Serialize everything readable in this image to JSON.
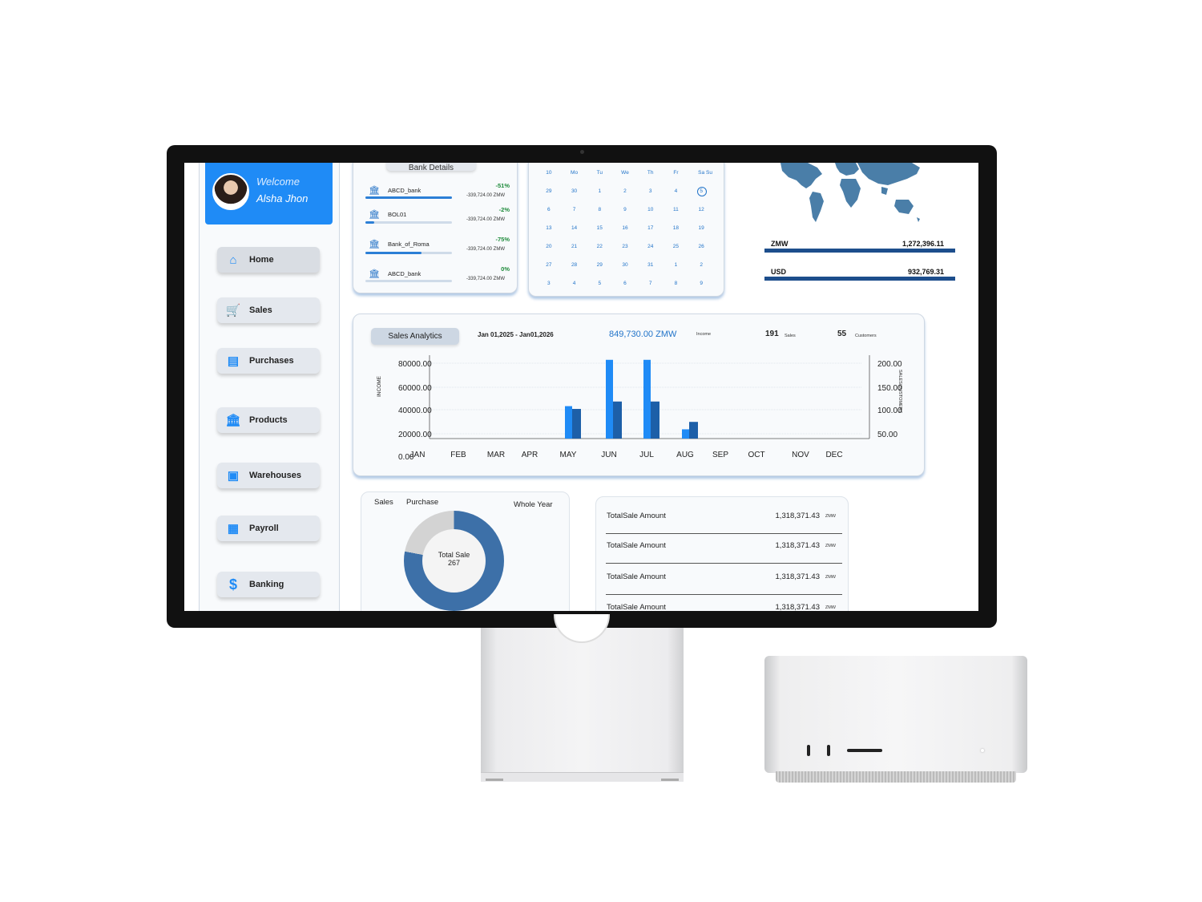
{
  "user": {
    "welcome": "Welcome",
    "name": "Alsha Jhon"
  },
  "nav": [
    {
      "label": "Home",
      "icon": "home-icon"
    },
    {
      "label": "Sales",
      "icon": "cart-icon"
    },
    {
      "label": "Purchases",
      "icon": "clipboard-icon"
    },
    {
      "label": "Products",
      "icon": "bank-icon"
    },
    {
      "label": "Warehouses",
      "icon": "briefcase-icon"
    },
    {
      "label": "Payroll",
      "icon": "register-icon"
    },
    {
      "label": "Banking",
      "icon": "dollar-icon"
    }
  ],
  "bank_details": {
    "title": "Bank Details",
    "rows": [
      {
        "name": "ABCD_bank",
        "pct": "-51%",
        "amount": "-339,724.00 ZMW",
        "fill": 1.0
      },
      {
        "name": "BOL01",
        "pct": "-2%",
        "amount": "-339,724.00 ZMW",
        "fill": 0.1
      },
      {
        "name": "Bank_of_Roma",
        "pct": "-75%",
        "amount": "-339,724.00 ZMW",
        "fill": 0.65
      },
      {
        "name": "ABCD_bank",
        "pct": "0%",
        "amount": "-339,724.00 ZMW",
        "fill": 0
      }
    ]
  },
  "calendar": {
    "headers": [
      "10",
      "Mo",
      "Tu",
      "We",
      "Th",
      "Fr",
      "Sa",
      "Su"
    ],
    "days": [
      "29",
      "30",
      "1",
      "2",
      "3",
      "4",
      "5",
      "6",
      "7",
      "8",
      "9",
      "10",
      "11",
      "12",
      "13",
      "14",
      "15",
      "16",
      "17",
      "18",
      "19",
      "20",
      "21",
      "22",
      "23",
      "24",
      "25",
      "26",
      "27",
      "28",
      "29",
      "30",
      "31",
      "1",
      "2",
      "3",
      "4",
      "5",
      "6",
      "7",
      "8",
      "9"
    ],
    "today_index": 6
  },
  "currencies": [
    {
      "label": "ZMW",
      "value": "1,272,396.11"
    },
    {
      "label": "USD",
      "value": "932,769.31"
    }
  ],
  "sales_analytics": {
    "tab": "Sales Analytics",
    "date_range": "Jan 01,2025 - Jan01,2026",
    "income_value": "849,730.00 ZMW",
    "income_label": "Income",
    "sales_count": "191",
    "sales_label": "Sales",
    "customers_count": "55",
    "customers_label": "Customers"
  },
  "chart_data": {
    "type": "bar",
    "categories": [
      "JAN",
      "FEB",
      "MAR",
      "APR",
      "MAY",
      "JUN",
      "JUL",
      "AUG",
      "SEP",
      "OCT",
      "NOV",
      "DEC"
    ],
    "series": [
      {
        "axis": "left",
        "color": "#1f8bf6",
        "values": [
          0,
          0,
          0,
          0,
          35000,
          85000,
          85000,
          10000,
          0,
          0,
          0,
          0
        ]
      },
      {
        "axis": "right",
        "color": "#1d5fa8",
        "values": [
          0,
          0,
          0,
          0,
          80,
          100,
          100,
          45,
          0,
          0,
          0,
          0
        ]
      }
    ],
    "ylabel": "INCOME",
    "y2label": "SALES/CUSTOMERS",
    "yticks": [
      "80000.00",
      "60000.00",
      "40000.00",
      "20000.00",
      "0.00"
    ],
    "y2ticks": [
      "200.00",
      "150.00",
      "100.00",
      "50.00"
    ],
    "ylim": [
      0,
      90000
    ],
    "y2lim": [
      0,
      225
    ]
  },
  "donut": {
    "legend_sales": "Sales",
    "legend_purchase": "Purchase",
    "period": "Whole Year",
    "center_label": "Total Sale",
    "center_value": "267",
    "sales_share": 0.78
  },
  "totals": [
    {
      "label": "TotalSale Amount",
      "value": "1,318,371.43",
      "unit": "ZMW"
    },
    {
      "label": "TotalSale Amount",
      "value": "1,318,371.43",
      "unit": "ZMW"
    },
    {
      "label": "TotalSale Amount",
      "value": "1,318,371.43",
      "unit": "ZMW"
    },
    {
      "label": "TotalSale Amount",
      "value": "1,318,371.43",
      "unit": "ZMW"
    }
  ],
  "colors": {
    "accent": "#1f8bf6",
    "dark_blue": "#1d4e8c",
    "positive": "#1d8a3a"
  }
}
